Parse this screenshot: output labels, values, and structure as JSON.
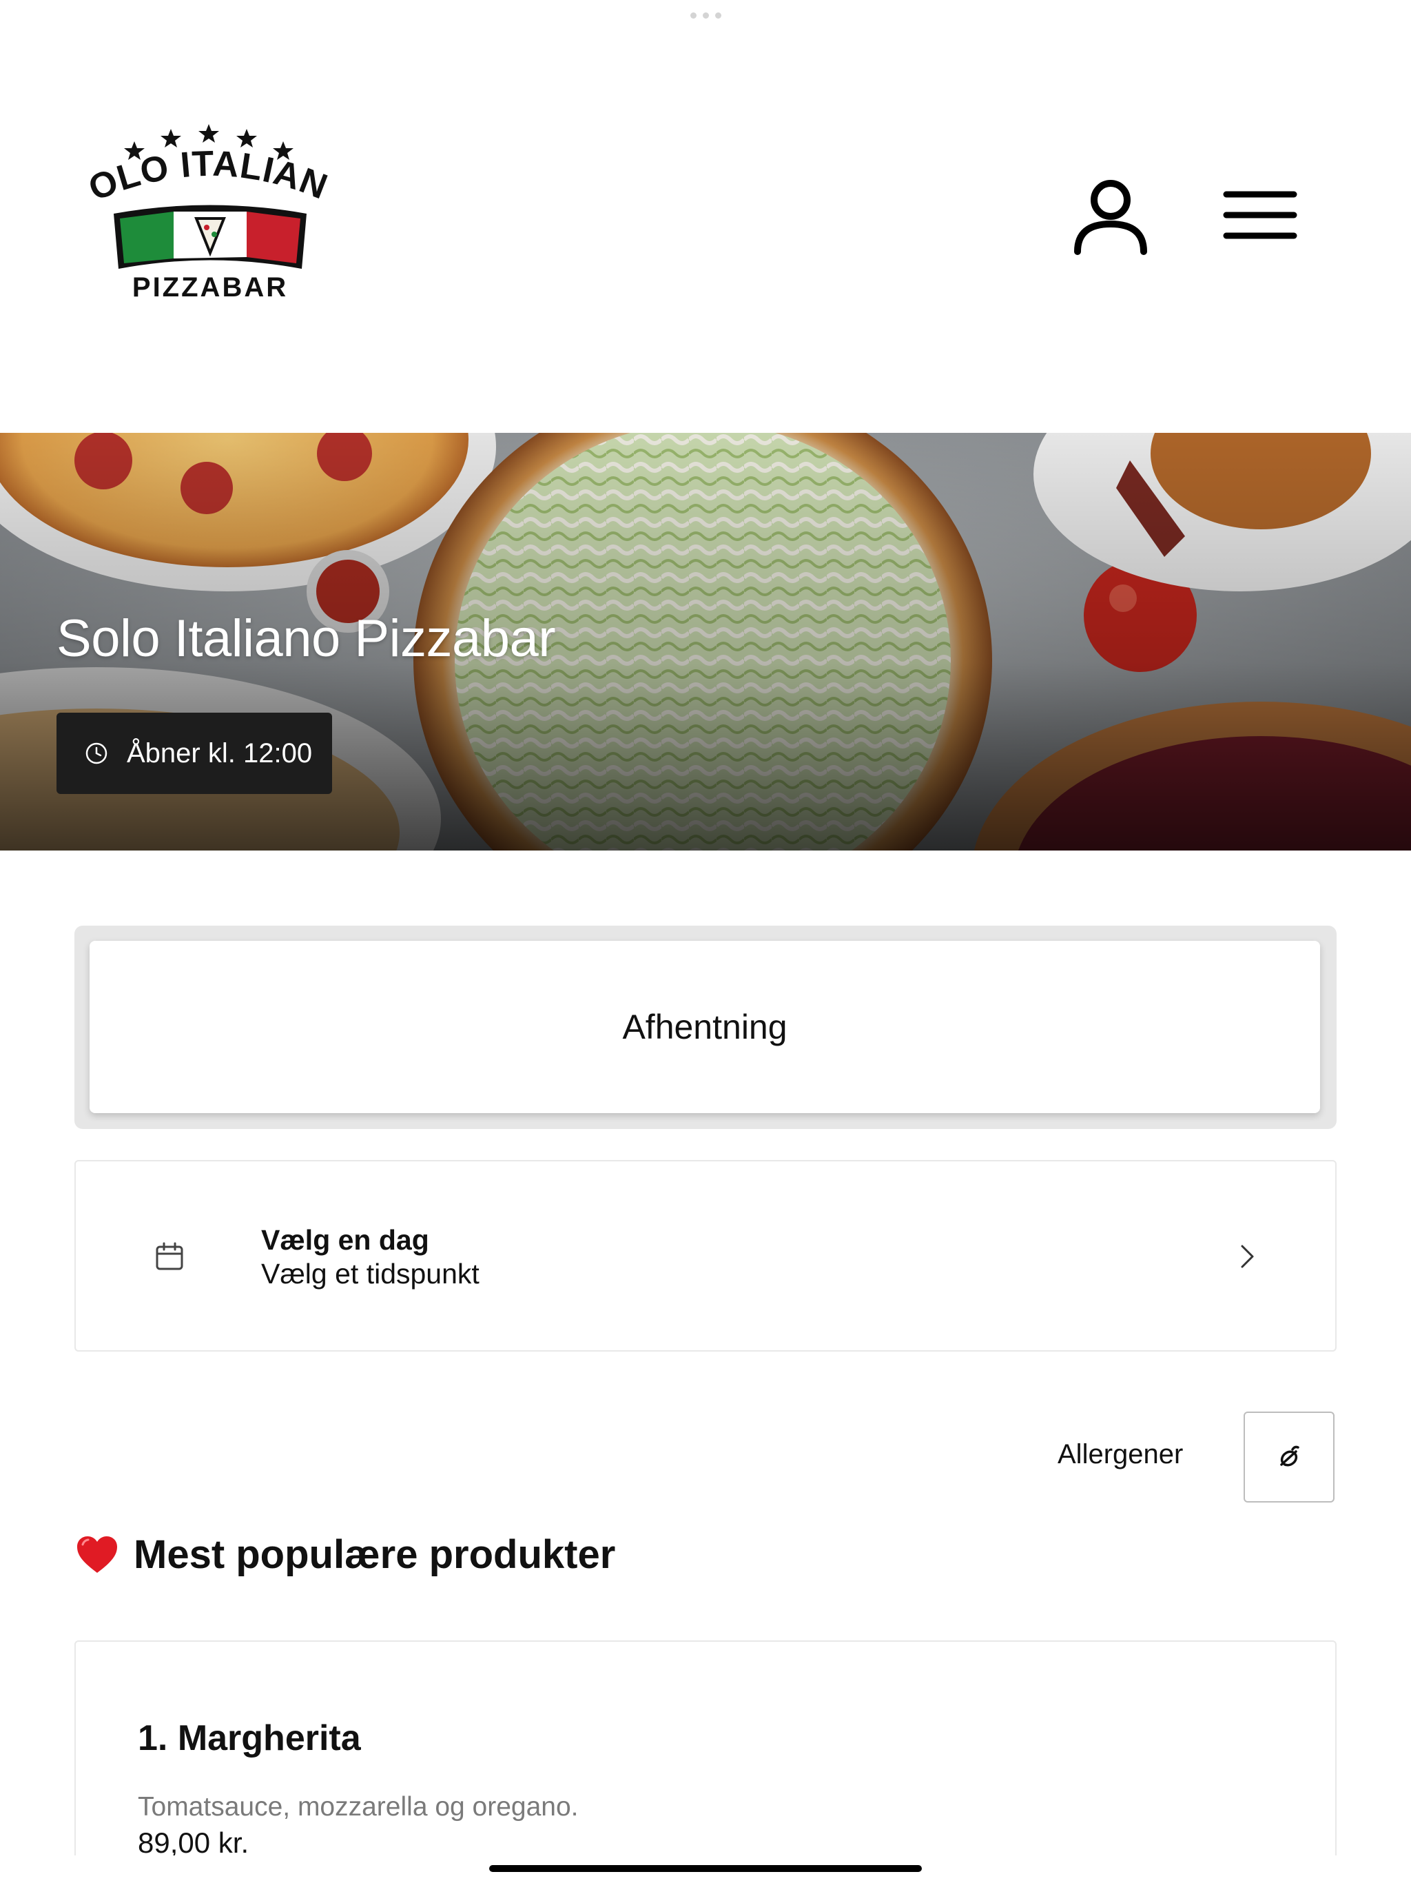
{
  "app": {
    "restaurant_name": "Solo Italiano Pizzabar"
  },
  "header": {
    "logo_top_text": "SOLO ITALIANO",
    "logo_bottom_text": "PIZZABAR",
    "logo_stars": 5,
    "flag_colors": [
      "#1e8c3a",
      "#ffffff",
      "#c8202c"
    ],
    "account_icon": "user-icon",
    "menu_icon": "hamburger-menu-icon"
  },
  "hero": {
    "title": "Solo Italiano Pizzabar",
    "opening_status": "Åbner kl. 12:00",
    "status_icon": "clock-icon"
  },
  "order_mode": {
    "selected_label": "Afhentning"
  },
  "schedule": {
    "day_label": "Vælg en dag",
    "time_label": "Vælg et tidspunkt",
    "icon": "calendar-icon",
    "chevron_icon": "chevron-right-icon"
  },
  "allergens": {
    "label": "Allergener",
    "button_icon": "allergen-filter-icon"
  },
  "popular": {
    "heading": "Mest populære produkter",
    "heading_icon": "red-heart-icon",
    "products": [
      {
        "name": "1. Margherita",
        "description": "Tomatsauce, mozzarella og oregano.",
        "price": "89,00 kr."
      }
    ]
  }
}
